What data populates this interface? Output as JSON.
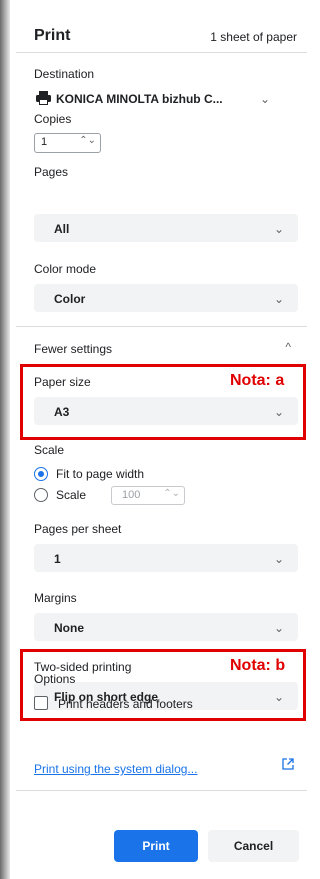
{
  "header": {
    "title": "Print",
    "sheets": "1 sheet of paper"
  },
  "destination": {
    "label": "Destination",
    "value": "KONICA MINOLTA bizhub C...",
    "icon": "printer-icon"
  },
  "copies": {
    "label": "Copies",
    "value": "1"
  },
  "pages": {
    "label": "Pages",
    "value": "All"
  },
  "color_mode": {
    "label": "Color mode",
    "value": "Color"
  },
  "fewer_settings": {
    "label": "Fewer settings",
    "icon": "chevron-up-icon"
  },
  "paper_size": {
    "label": "Paper size",
    "value": "A3"
  },
  "scale": {
    "label": "Scale",
    "option_fit": "Fit to page width",
    "option_scale": "Scale",
    "scale_value": "100",
    "selected": "fit"
  },
  "pages_per_sheet": {
    "label": "Pages per sheet",
    "value": "1"
  },
  "margins": {
    "label": "Margins",
    "value": "None"
  },
  "two_sided": {
    "label": "Two-sided printing",
    "value": "Flip on short edge"
  },
  "options": {
    "label": "Options",
    "headers_footers": "Print headers and footers"
  },
  "system_dialog_link": "Print using the system dialog...",
  "buttons": {
    "print": "Print",
    "cancel": "Cancel"
  },
  "annotations": {
    "a": "Nota: a",
    "b": "Nota: b",
    "color": "#e00000"
  },
  "colors": {
    "accent": "#1a73e8",
    "field_bg": "#f1f3f4"
  }
}
